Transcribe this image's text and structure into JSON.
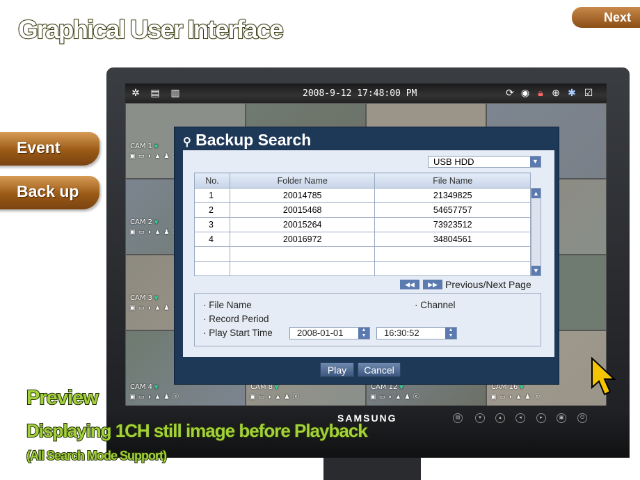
{
  "page": {
    "title": "Graphical User Interface",
    "next_label": "Next",
    "side_buttons": [
      {
        "label": "Event"
      },
      {
        "label": "Back up"
      }
    ],
    "preview": {
      "heading": "Preview",
      "line1": "Displaying 1CH still image before Playback",
      "line2": "(All Search Mode Support)"
    }
  },
  "dvr": {
    "datetime": "2008-9-12 17:48:00 PM",
    "left_status_icons": [
      "fan-error-icon",
      "hdd-full-icon",
      "hdd-error-icon"
    ],
    "right_status_icons": [
      "ftp-icon",
      "backup-disc-icon",
      "rec-lock-icon",
      "zoom-icon",
      "freeze-icon",
      "checklist-icon"
    ],
    "cameras": [
      {
        "label": "CAM 1"
      },
      {
        "label": "CAM 2"
      },
      {
        "label": "CAM 3"
      },
      {
        "label": "CAM 4"
      },
      {
        "label": "CAM 8"
      },
      {
        "label": "CAM 12"
      },
      {
        "label": "CAM 16"
      }
    ],
    "brand": "SAMSUNG"
  },
  "dialog": {
    "title": "Backup Search",
    "device": "USB HDD",
    "columns": [
      "No.",
      "Folder Name",
      "File Name"
    ],
    "rows": [
      [
        "1",
        "20014785",
        "21349825"
      ],
      [
        "2",
        "20015468",
        "54657757"
      ],
      [
        "3",
        "20015264",
        "73923512"
      ],
      [
        "4",
        "20016972",
        "34804561"
      ],
      [
        "",
        "",
        ""
      ],
      [
        "",
        "",
        ""
      ]
    ],
    "page_label": "Previous/Next Page",
    "info": {
      "file_name": "· File Name",
      "channel": "· Channel",
      "record_period": "· Record Period",
      "play_start_time": "· Play Start Time",
      "date": "2008-01-01",
      "time": "16:30:52"
    },
    "play": "Play",
    "cancel": "Cancel"
  },
  "colors": {
    "dialog_bg": "#1e3858",
    "panel_bg": "#e6ecf5",
    "accent": "#5a7ab0",
    "preview_green": "#a3d13a",
    "brown": "#9a5a16"
  }
}
